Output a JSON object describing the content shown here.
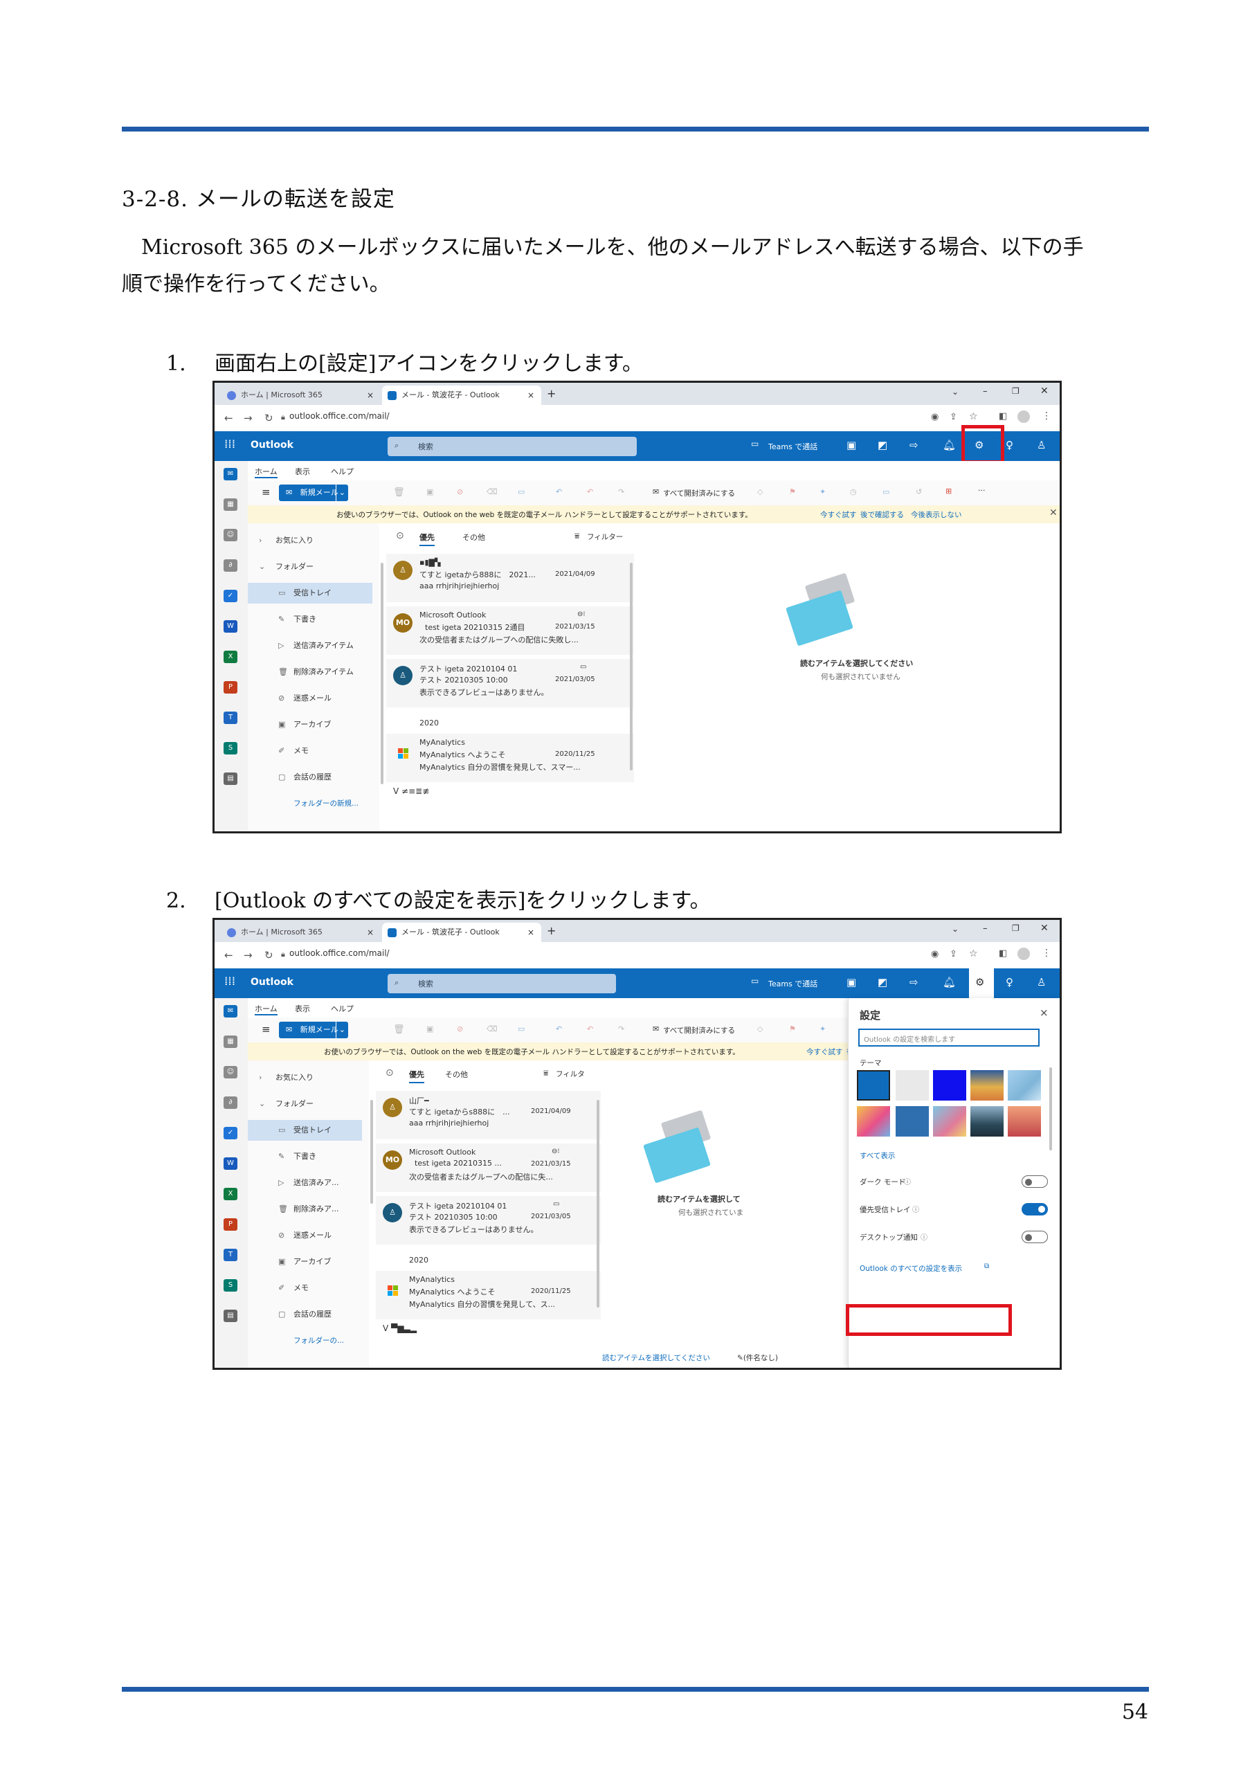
{
  "document": {
    "section_title": "3-2-8. メールの転送を設定",
    "intro_line1": "Microsoft 365 のメールボックスに届いたメールを、他のメールアドレスへ転送する場合、以下の手",
    "intro_line2": "順で操作を行ってください。",
    "steps": [
      {
        "num": "1.",
        "text": "画面右上の[設定]アイコンをクリックします。"
      },
      {
        "num": "2.",
        "text": "[Outlook のすべての設定を表示]をクリックします。"
      }
    ],
    "page_number": "54"
  },
  "browser": {
    "tab1": "ホーム | Microsoft 365",
    "tab2": "メール - 筑波花子 - Outlook",
    "url": "outlook.office.com/mail/",
    "tab_close": "×",
    "new_tab": "+"
  },
  "outlook": {
    "brand": "Outlook",
    "search_placeholder": "検索",
    "teams_call": "Teams で通話",
    "menu": [
      "ホーム",
      "表示",
      "ヘルプ"
    ],
    "new_mail": "新規メール",
    "mark_all_read": "すべて開封済みにする",
    "info_bar": "お使いのブラウザーでは、Outlook on the web を既定の電子メール ハンドラーとして設定することがサポートされています。",
    "info_try": "今すぐ試す",
    "info_later": "後で確認する",
    "info_never": "今後表示しない",
    "folders": {
      "favorites": "お気に入り",
      "folders": "フォルダー",
      "items": [
        "受信トレイ",
        "下書き",
        "送信済みアイテム",
        "削除済みアイテム",
        "迷惑メール",
        "アーカイブ",
        "メモ",
        "会話の履歴"
      ],
      "items_short": [
        "受信トレイ",
        "下書き",
        "送信済みア...",
        "削除済みア...",
        "迷惑メール",
        "アーカイブ",
        "メモ",
        "会話の履歴"
      ],
      "new_folder": "フォルダーの新規...",
      "new_folder_short": "フォルダーの..."
    },
    "list_tabs": {
      "focused": "優先",
      "other": "その他",
      "filter": "フィルター",
      "filter_short": "フィルタ"
    },
    "messages": [
      {
        "subject": "てすと igetaから888に　2021...",
        "subject_short": "てすと igetaからs888に　...",
        "date": "2021/04/09",
        "preview": "aaa rrhjrihjriejhierhoj"
      },
      {
        "sender": "Microsoft Outlook",
        "avatar": "MO",
        "subject": "test igeta 20210315 2通目",
        "subject_short": "test igeta 20210315 ...",
        "date": "2021/03/15",
        "preview": "次の受信者またはグループへの配信に失敗し...",
        "preview_short": "次の受信者またはグループへの配信に失..."
      },
      {
        "sender": "テスト igeta 20210104 01",
        "subject": "テスト 20210305 10:00",
        "date": "2021/03/05",
        "preview": "表示できるプレビューはありません。"
      },
      {
        "sender": "MyAnalytics",
        "subject": "MyAnalytics へようこそ",
        "date": "2020/11/25",
        "preview": "MyAnalytics 自分の習慣を発見して、スマー...",
        "preview_short": "MyAnalytics 自分の習慣を発見して、ス..."
      }
    ],
    "year_header": "2020",
    "reading_title": "読むアイテムを選択してください",
    "reading_sub": "何も選択されていません",
    "reading_title_cut": "読むアイテムを選択して",
    "reading_sub_cut": "何も選択されていま",
    "bottom_read": "読むアイテムを選択してください",
    "bottom_subject": "(件名なし)",
    "toolbar_more": "···"
  },
  "settings_panel": {
    "title": "設定",
    "search_placeholder": "Outlook の設定を検索します",
    "theme_label": "テーマ",
    "show_all": "すべて表示",
    "dark_mode": "ダーク モード",
    "focused_inbox": "優先受信トレイ",
    "desktop_notify": "デスクトップ通知",
    "view_all_settings": "Outlook のすべての設定を表示",
    "close": "×",
    "theme_colors": [
      "#0f6cbd",
      "#e9e9e9",
      "#1010ee",
      "#d8a43a",
      "#7fb5d8",
      "#e8508a",
      "#2f6fb0",
      "#e07a9a",
      "#2b4a5a",
      "#c2464b"
    ]
  },
  "colors": {
    "rule": "#1f5ba8",
    "outlook_blue": "#0f6cbd",
    "highlight_red": "#e0141e"
  }
}
